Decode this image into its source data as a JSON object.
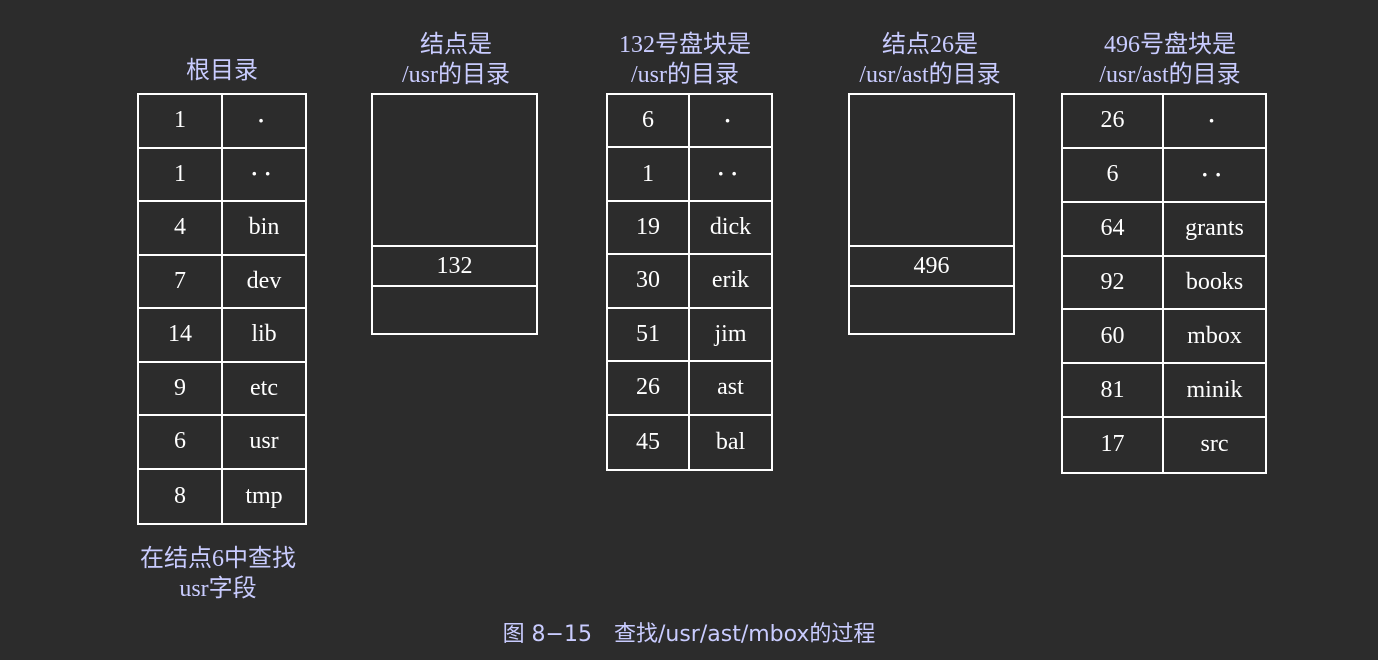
{
  "root": {
    "title": "根目录",
    "rows": [
      {
        "num": "1",
        "name": "·"
      },
      {
        "num": "1",
        "name": "··"
      },
      {
        "num": "4",
        "name": "bin"
      },
      {
        "num": "7",
        "name": "dev"
      },
      {
        "num": "14",
        "name": "lib"
      },
      {
        "num": "9",
        "name": "etc"
      },
      {
        "num": "6",
        "name": "usr"
      },
      {
        "num": "8",
        "name": "tmp"
      }
    ],
    "note_line1": "在结点6中查找",
    "note_line2": "usr字段"
  },
  "inode_usr": {
    "title_line1": "结点是",
    "title_line2": "/usr的目录",
    "value": "132"
  },
  "block_132": {
    "title_line1": "132号盘块是",
    "title_line2": "/usr的目录",
    "rows": [
      {
        "num": "6",
        "name": "·"
      },
      {
        "num": "1",
        "name": "··"
      },
      {
        "num": "19",
        "name": "dick"
      },
      {
        "num": "30",
        "name": "erik"
      },
      {
        "num": "51",
        "name": "jim"
      },
      {
        "num": "26",
        "name": "ast"
      },
      {
        "num": "45",
        "name": "bal"
      }
    ]
  },
  "inode_26": {
    "title_line1": "结点26是",
    "title_line2": "/usr/ast的目录",
    "value": "496"
  },
  "block_496": {
    "title_line1": "496号盘块是",
    "title_line2": "/usr/ast的目录",
    "rows": [
      {
        "num": "26",
        "name": "·"
      },
      {
        "num": "6",
        "name": "··"
      },
      {
        "num": "64",
        "name": "grants"
      },
      {
        "num": "92",
        "name": "books"
      },
      {
        "num": "60",
        "name": "mbox"
      },
      {
        "num": "81",
        "name": "minik"
      },
      {
        "num": "17",
        "name": "src"
      }
    ]
  },
  "caption": "图 8−15　查找/usr/ast/mbox的过程"
}
